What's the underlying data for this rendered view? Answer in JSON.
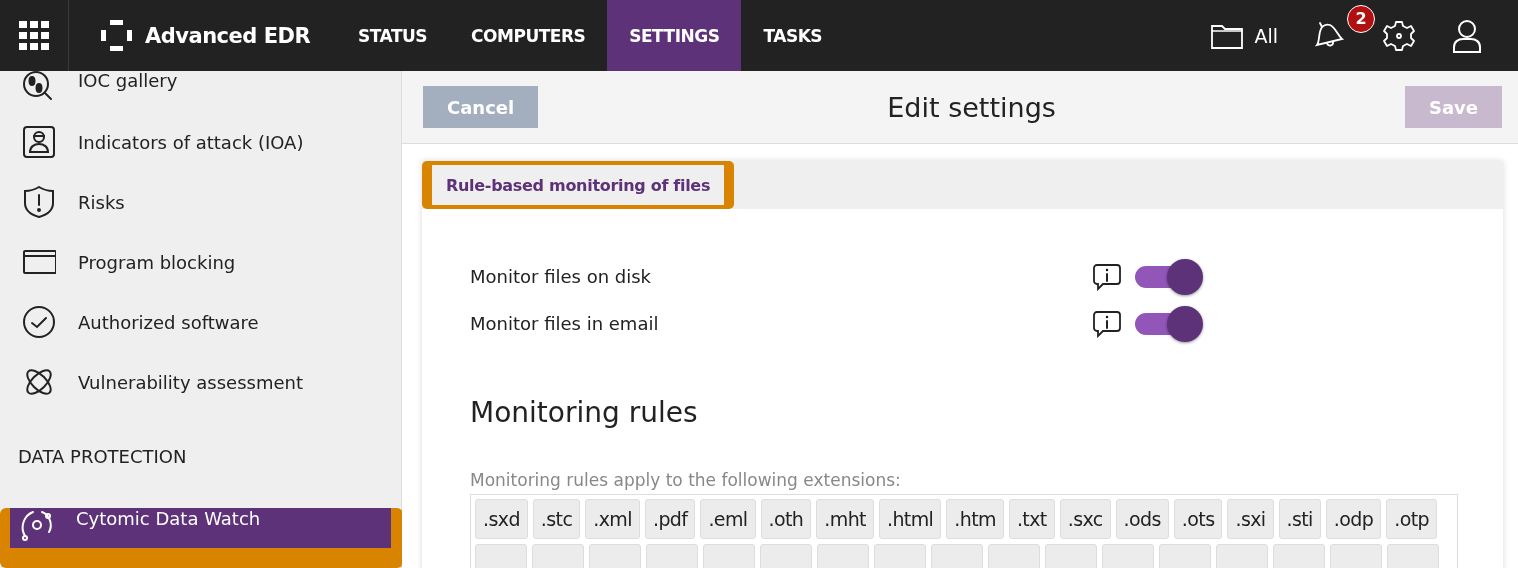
{
  "topbar": {
    "product": "Advanced EDR",
    "nav": [
      {
        "label": "STATUS",
        "selected": false
      },
      {
        "label": "COMPUTERS",
        "selected": false
      },
      {
        "label": "SETTINGS",
        "selected": true
      },
      {
        "label": "TASKS",
        "selected": false
      }
    ],
    "filter": "All",
    "notifications": "2"
  },
  "sidebar": {
    "items": [
      {
        "label": "IOC gallery",
        "selected": false
      },
      {
        "label": "Indicators of attack (IOA)",
        "selected": false
      },
      {
        "label": "Risks",
        "selected": false
      },
      {
        "label": "Program blocking",
        "selected": false
      },
      {
        "label": "Authorized software",
        "selected": false
      },
      {
        "label": "Vulnerability assessment",
        "selected": false
      }
    ],
    "section": "DATA PROTECTION",
    "section_items": [
      {
        "label": "Cytomic Data Watch",
        "selected": true,
        "highlighted": true
      }
    ]
  },
  "header": {
    "cancel": "Cancel",
    "title": "Edit settings",
    "save": "Save",
    "save_disabled": true
  },
  "card": {
    "tabs": [
      {
        "label": "Rule-based monitoring of files",
        "selected": true,
        "highlighted": true
      }
    ],
    "settings": [
      {
        "label": "Monitor files on disk",
        "on": true
      },
      {
        "label": "Monitor files in email",
        "on": true
      }
    ],
    "heading": "Monitoring rules",
    "hint": "Monitoring rules apply to the following extensions:",
    "extensions": [
      ".sxd",
      ".stc",
      ".xml",
      ".pdf",
      ".eml",
      ".oth",
      ".mht",
      ".html",
      ".htm",
      ".txt",
      ".sxc",
      ".ods",
      ".ots",
      ".sxi",
      ".sti",
      ".odp",
      ".otp"
    ]
  }
}
